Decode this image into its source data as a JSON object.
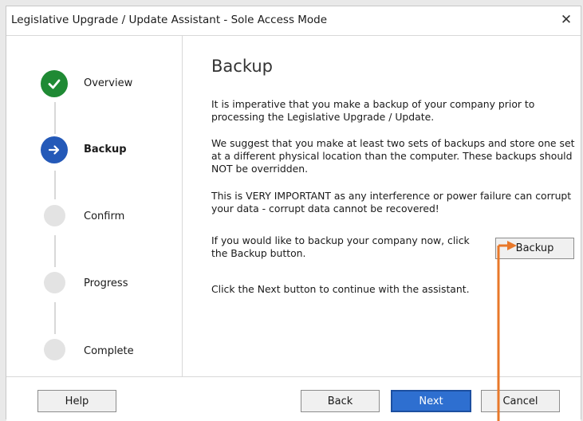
{
  "window": {
    "title": "Legislative Upgrade / Update Assistant - Sole Access Mode",
    "close_glyph": "✕"
  },
  "steps": [
    {
      "label": "Overview",
      "state": "done",
      "icon": "check-icon"
    },
    {
      "label": "Backup",
      "state": "active",
      "icon": "arrow-right-icon"
    },
    {
      "label": "Confirm",
      "state": "pending"
    },
    {
      "label": "Progress",
      "state": "pending"
    },
    {
      "label": "Complete",
      "state": "pending"
    }
  ],
  "content": {
    "heading": "Backup",
    "para1": "It is imperative that you make a backup of your company prior to processing the Legislative Upgrade / Update.",
    "para2": "We suggest that you make at least two sets of backups and store one set at a different physical location than the computer. These backups should NOT be overridden.",
    "para3": "This is VERY IMPORTANT as any interference or power failure can corrupt your data - corrupt data cannot be recovered!",
    "para4": "If you would like to backup your company now, click the Backup button.",
    "backup_button": "Backup",
    "para5": "Click the Next button to continue with the assistant."
  },
  "footer": {
    "help": "Help",
    "back": "Back",
    "next": "Next",
    "cancel": "Cancel"
  },
  "colors": {
    "done": "#1f8a34",
    "active": "#2459b8",
    "primary_button": "#2e6fd0",
    "annotation": "#e8782a"
  }
}
